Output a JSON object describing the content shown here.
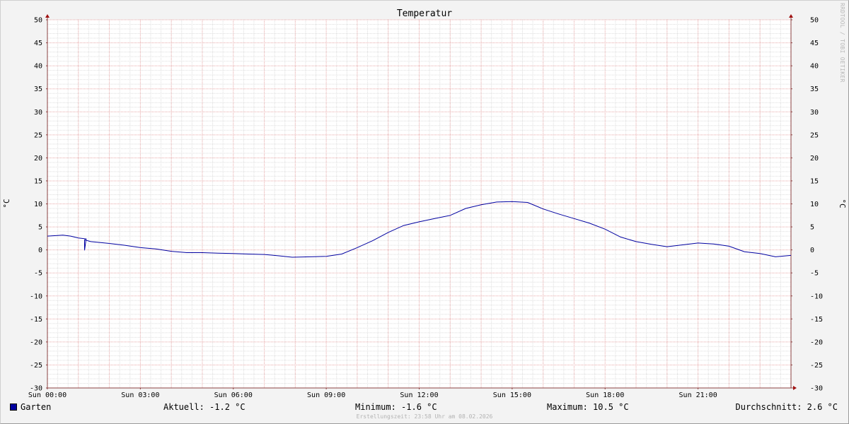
{
  "chart_data": {
    "type": "line",
    "title": "Temperatur",
    "ylabel_left": "°C",
    "ylabel_right": "°C",
    "ylim": [
      -30,
      50
    ],
    "y_ticks": [
      50,
      45,
      40,
      35,
      30,
      25,
      20,
      15,
      10,
      5,
      0,
      -5,
      -10,
      -15,
      -20,
      -25,
      -30
    ],
    "x_ticks": [
      "Sun 00:00",
      "Sun 03:00",
      "Sun 06:00",
      "Sun 09:00",
      "Sun 12:00",
      "Sun 15:00",
      "Sun 18:00",
      "Sun 21:00"
    ],
    "xlim_hours": [
      0,
      24
    ],
    "grid": true,
    "series": [
      {
        "name": "Garten",
        "color": "#0000a0",
        "x_hours": [
          0,
          0.5,
          0.75,
          1.0,
          1.25,
          1.2,
          1.2,
          1.4,
          2.0,
          2.5,
          3.0,
          3.5,
          4.0,
          4.5,
          5.0,
          5.5,
          6.0,
          6.5,
          7.0,
          7.5,
          7.9,
          8.5,
          9.0,
          9.5,
          10.0,
          10.5,
          11.0,
          11.5,
          12.0,
          12.5,
          13.0,
          13.5,
          14.0,
          14.5,
          15.0,
          15.5,
          16.0,
          16.5,
          17.0,
          17.5,
          18.0,
          18.5,
          19.0,
          19.5,
          20.0,
          20.5,
          21.0,
          21.5,
          22.0,
          22.5,
          23.0,
          23.5,
          24.0
        ],
        "values": [
          3.0,
          3.2,
          3.0,
          2.6,
          2.4,
          -0.1,
          2.2,
          1.8,
          1.4,
          1.0,
          0.5,
          0.2,
          -0.3,
          -0.6,
          -0.6,
          -0.7,
          -0.8,
          -0.9,
          -1.0,
          -1.3,
          -1.6,
          -1.5,
          -1.4,
          -0.9,
          0.5,
          2.0,
          3.8,
          5.3,
          6.1,
          6.8,
          7.5,
          9.0,
          9.8,
          10.4,
          10.5,
          10.3,
          8.9,
          7.8,
          6.8,
          5.8,
          4.5,
          2.8,
          1.8,
          1.2,
          0.7,
          1.1,
          1.5,
          1.3,
          0.8,
          -0.4,
          -0.8,
          -1.5,
          -1.2
        ]
      }
    ]
  },
  "legend": {
    "series_label": "Garten",
    "series_color": "#0000a0",
    "current": "Aktuell: -1.2 °C",
    "minimum": "Minimum: -1.6 °C",
    "maximum": "Maximum: 10.5 °C",
    "average": "Durchschnitt: 2.6 °C"
  },
  "credit": "RRDTOOL / TOBI OETIKER",
  "footer": "Erstellungszeit: 23:58 Uhr am 08.02.2026",
  "colors": {
    "background": "#f3f3f3",
    "plot": "#ffffff",
    "grid_minor": "#dedede",
    "grid_major": "#e8a7a7",
    "axis": "#8b4040",
    "line": "#0000a0"
  }
}
